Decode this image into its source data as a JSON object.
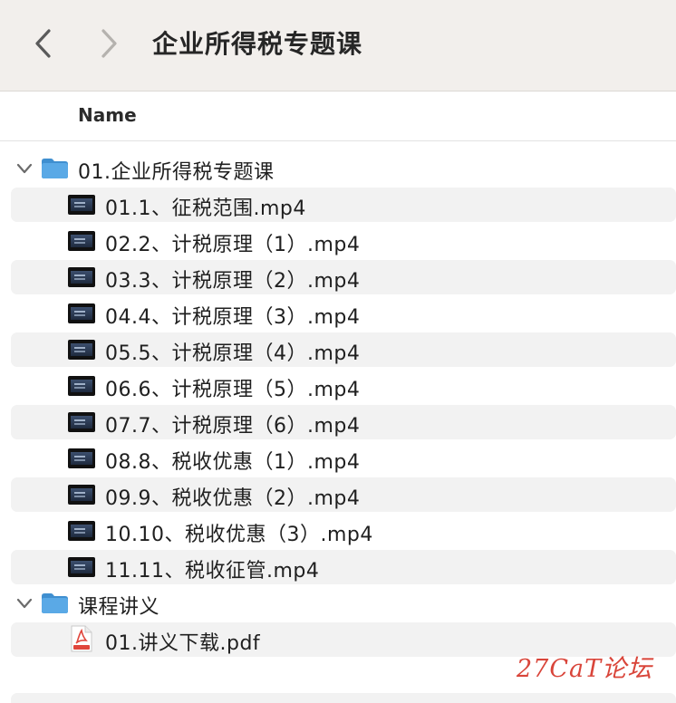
{
  "window": {
    "title": "企业所得税专题课"
  },
  "toolbar": {
    "back_icon": "chevron-left-icon",
    "forward_icon": "chevron-right-icon"
  },
  "columns": {
    "name": "Name"
  },
  "folders": [
    {
      "name": "01.企业所得税专题课",
      "expanded": true,
      "files": [
        {
          "name": "01.1、征税范围.mp4",
          "type": "video"
        },
        {
          "name": "02.2、计税原理（1）.mp4",
          "type": "video"
        },
        {
          "name": "03.3、计税原理（2）.mp4",
          "type": "video"
        },
        {
          "name": "04.4、计税原理（3）.mp4",
          "type": "video"
        },
        {
          "name": "05.5、计税原理（4）.mp4",
          "type": "video"
        },
        {
          "name": "06.6、计税原理（5）.mp4",
          "type": "video"
        },
        {
          "name": "07.7、计税原理（6）.mp4",
          "type": "video"
        },
        {
          "name": "08.8、税收优惠（1）.mp4",
          "type": "video"
        },
        {
          "name": "09.9、税收优惠（2）.mp4",
          "type": "video"
        },
        {
          "name": "10.10、税收优惠（3）.mp4",
          "type": "video"
        },
        {
          "name": "11.11、税收征管.mp4",
          "type": "video"
        }
      ]
    },
    {
      "name": "课程讲义",
      "expanded": true,
      "files": [
        {
          "name": "01.讲义下载.pdf",
          "type": "pdf"
        }
      ]
    }
  ],
  "watermark": "27CaT论坛",
  "colors": {
    "folder": "#5aa9e6",
    "stripe": "#f2f2f2",
    "titlebar": "#f2efec",
    "watermark": "#d9453a",
    "pdf": "#e0463c"
  }
}
